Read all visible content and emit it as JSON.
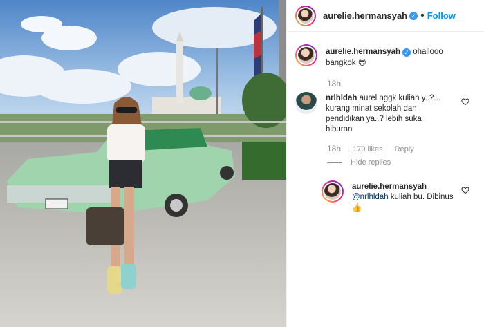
{
  "post": {
    "author": "aurelie.hermansyah",
    "follow_label": "Follow",
    "dot": "•"
  },
  "caption": {
    "username": "aurelie.hermansyah",
    "text": "ohallooo bangkok",
    "emoji": "😍",
    "time": "18h"
  },
  "comment1": {
    "username": "nrlhldah",
    "text": "aurel nggk kuliah y..?... kurang minat sekolah dan pendidikan ya..? lebih suka hiburan",
    "time": "18h",
    "likes": "179 likes",
    "reply_label": "Reply",
    "hide_replies": "Hide replies"
  },
  "reply1": {
    "username": "aurelie.hermansyah",
    "mention": "@nrlhldah",
    "text": "kuliah bu. Dibinus",
    "emoji": "👍"
  },
  "colors": {
    "accent": "#0095f6",
    "verified": "#3897f0",
    "meta": "#8e8e8e"
  },
  "icons": {
    "verified": "verified-badge-icon",
    "heart": "heart-outline-icon"
  }
}
